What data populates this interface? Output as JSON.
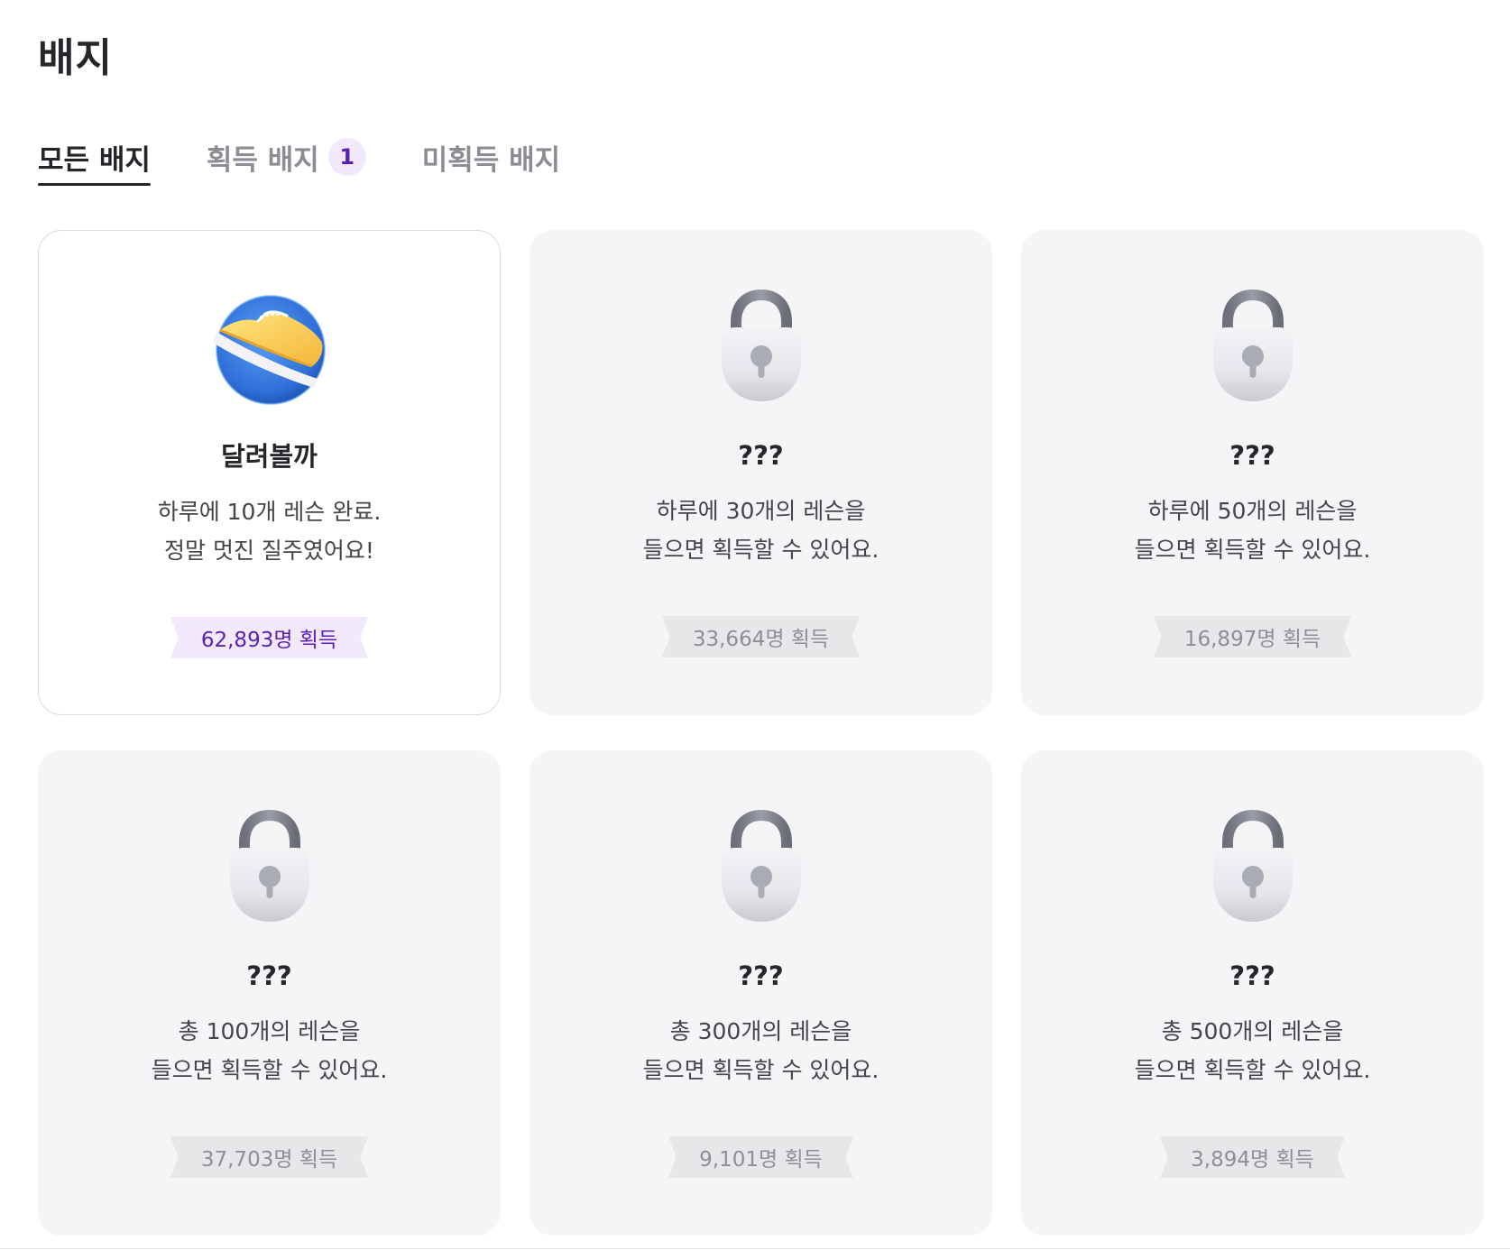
{
  "page": {
    "title": "배지"
  },
  "tabs": [
    {
      "label": "모든 배지",
      "active": true
    },
    {
      "label": "획득 배지",
      "count": "1",
      "active": false
    },
    {
      "label": "미획득 배지",
      "active": false
    }
  ],
  "badges": [
    {
      "name": "달려볼까",
      "desc_line1": "하루에 10개 레슨 완료.",
      "desc_line2": "정말 멋진 질주였어요!",
      "earned_count": "62,893명 획득",
      "earned": true,
      "icon": "running-shoe-icon"
    },
    {
      "name": "???",
      "desc_line1": "하루에 30개의 레슨을",
      "desc_line2": "들으면 획득할 수 있어요.",
      "earned_count": "33,664명 획득",
      "earned": false,
      "icon": "lock-icon"
    },
    {
      "name": "???",
      "desc_line1": "하루에 50개의 레슨을",
      "desc_line2": "들으면 획득할 수 있어요.",
      "earned_count": "16,897명 획득",
      "earned": false,
      "icon": "lock-icon"
    },
    {
      "name": "???",
      "desc_line1": "총 100개의 레슨을",
      "desc_line2": "들으면 획득할 수 있어요.",
      "earned_count": "37,703명 획득",
      "earned": false,
      "icon": "lock-icon"
    },
    {
      "name": "???",
      "desc_line1": "총 300개의 레슨을",
      "desc_line2": "들으면 획득할 수 있어요.",
      "earned_count": "9,101명 획득",
      "earned": false,
      "icon": "lock-icon"
    },
    {
      "name": "???",
      "desc_line1": "총 500개의 레슨을",
      "desc_line2": "들으면 획득할 수 있어요.",
      "earned_count": "3,894명 획득",
      "earned": false,
      "icon": "lock-icon"
    }
  ],
  "colors": {
    "accent": "#5a1fb6",
    "accent_bg": "#f3e9fd",
    "locked_card_bg": "#f5f5f7",
    "locked_ribbon_bg": "#e7e7ea"
  }
}
